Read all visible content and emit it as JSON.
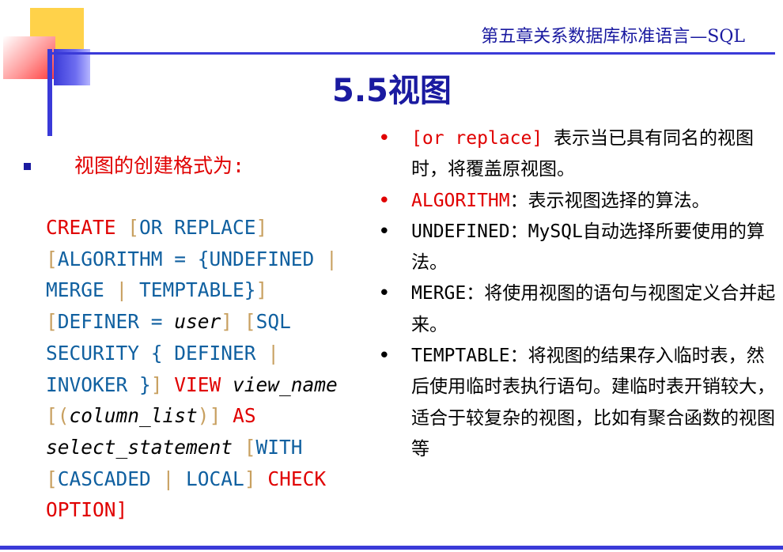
{
  "header": {
    "chapter": "第五章关系数据库标准语言—SQL"
  },
  "title": {
    "number": "5.5",
    "text": "视图"
  },
  "left": {
    "heading": "视图的创建格式为:",
    "code": {
      "l1_create": "CREATE",
      "l1_bracket_open": " [",
      "l1_or_replace": "OR REPLACE",
      "l1_bracket_close": "]",
      "l2_bracket_open": "[",
      "l2_algorithm": "ALGORITHM = {UNDEFINED ",
      "l2_pipe": "|",
      "l3_merge": "MERGE ",
      "l3_pipe": "|",
      "l3_temptable": " TEMPTABLE}",
      "l3_bracket_close": "]",
      "l4_bracket_open": "[",
      "l4_definer": "DEFINER = ",
      "l4_user": "user",
      "l4_bracket_close": "]",
      "l4_bracket_open2": " [",
      "l4_sql": "SQL",
      "l5_security": "SECURITY { DEFINER ",
      "l5_pipe": "|",
      "l6_invoker": "INVOKER }",
      "l6_bracket_close": "]",
      "l6_view": " VIEW ",
      "l6_view_name": "view_name",
      "l7_bracket_open": "[",
      "l7_paren_open": "(",
      "l7_column_list": "column_list",
      "l7_paren_close": ")",
      "l7_bracket_close": "]",
      "l7_as": " AS",
      "l8_select_statement": "select_statement",
      "l8_bracket_open": " [",
      "l8_with": "WITH",
      "l9_bracket_open": "[",
      "l9_cascaded": "CASCADED ",
      "l9_pipe": "|",
      "l9_local": " LOCAL",
      "l9_bracket_close": "]",
      "l9_check": " CHECK",
      "l10_option": "OPTION",
      "l10_bracket_close": "]"
    }
  },
  "right": {
    "items": [
      {
        "keyword": "[or replace]",
        "text": " 表示当已具有同名的视图时，将覆盖原视图。"
      },
      {
        "keyword": "ALGORITHM",
        "text": "：表示视图选择的算法。"
      },
      {
        "keyword": "UNDEFINED",
        "text": "：MySQL自动选择所要使用的算法。"
      },
      {
        "keyword": "MERGE",
        "text": "：将使用视图的语句与视图定义合并起来。"
      },
      {
        "keyword": "TEMPTABLE",
        "text": "：将视图的结果存入临时表，然后使用临时表执行语句。建临时表开销较大，适合于较复杂的视图，比如有聚合函数的视图等"
      }
    ]
  },
  "colors": {
    "red": "#e00000",
    "blue_code": "#1060a0",
    "bracket_gold": "#c8a060",
    "title_blue": "#1a1aa0",
    "accent_line": "#3a3ad8"
  }
}
